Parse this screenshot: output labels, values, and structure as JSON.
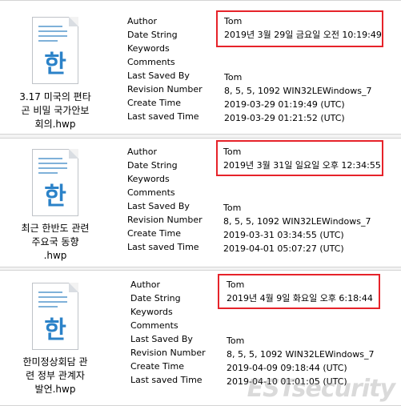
{
  "labels": [
    "Author",
    "Date String",
    "Keywords",
    "Comments",
    "Last Saved By",
    "Revision Number",
    "Create Time",
    "Last saved Time"
  ],
  "files": [
    {
      "icon_glyph": "한",
      "filename_lines": [
        "3.17 미국의 편타",
        "곤 비밀 국가안보",
        "회의.hwp"
      ],
      "author": "Tom",
      "date_string": "2019년 3월 29일 금요일 오전 10:19:49",
      "keywords": "",
      "comments": "",
      "last_saved_by": "Tom",
      "revision_number": "8, 5, 5, 1092 WIN32LEWindows_7",
      "create_time": "2019-03-29 01:19:49 (UTC)",
      "last_saved_time": "2019-03-29 01:21:52 (UTC)"
    },
    {
      "icon_glyph": "한",
      "filename_lines": [
        "최근 한반도 관련",
        "주요국 동향",
        ".hwp"
      ],
      "author": "Tom",
      "date_string": "2019년 3월 31일 일요일 오후 12:34:55",
      "keywords": "",
      "comments": "",
      "last_saved_by": "Tom",
      "revision_number": "8, 5, 5, 1092 WIN32LEWindows_7",
      "create_time": "2019-03-31 03:34:55 (UTC)",
      "last_saved_time": "2019-04-01 05:07:27 (UTC)"
    },
    {
      "icon_glyph": "한",
      "filename_lines": [
        "한미정상회담 관",
        "련 정부 관계자",
        "발언.hwp"
      ],
      "author": "Tom",
      "date_string": "2019년 4월 9일 화요일 오후 6:18:44",
      "keywords": "",
      "comments": "",
      "last_saved_by": "Tom",
      "revision_number": "8, 5, 5, 1092 WIN32LEWindows_7",
      "create_time": "2019-04-09 09:18:44 (UTC)",
      "last_saved_time": "2019-04-10 01:01:05 (UTC)"
    }
  ],
  "watermark": "ESTsecurity",
  "colors": {
    "highlight": "#e6232a",
    "icon_accent": "#2b82c8"
  }
}
